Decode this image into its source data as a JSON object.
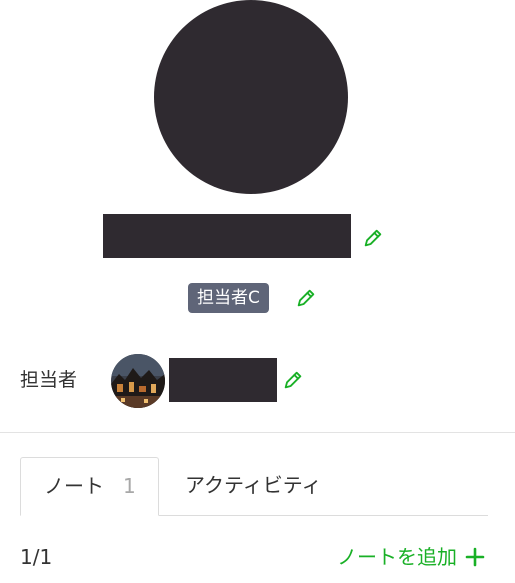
{
  "profile": {
    "tag_label": "担当者C"
  },
  "assignee": {
    "label": "担当者"
  },
  "tabs": [
    {
      "label": "ノート",
      "count": "1",
      "active": true
    },
    {
      "label": "アクティビティ",
      "active": false
    }
  ],
  "notes": {
    "pagination": "1/1",
    "add_label": "ノートを追加"
  },
  "colors": {
    "accent_green": "#19b026",
    "badge_bg": "#5f6578",
    "redacted": "#2f2a30"
  },
  "icons": {
    "edit": "pencil-icon",
    "add": "plus-icon"
  }
}
